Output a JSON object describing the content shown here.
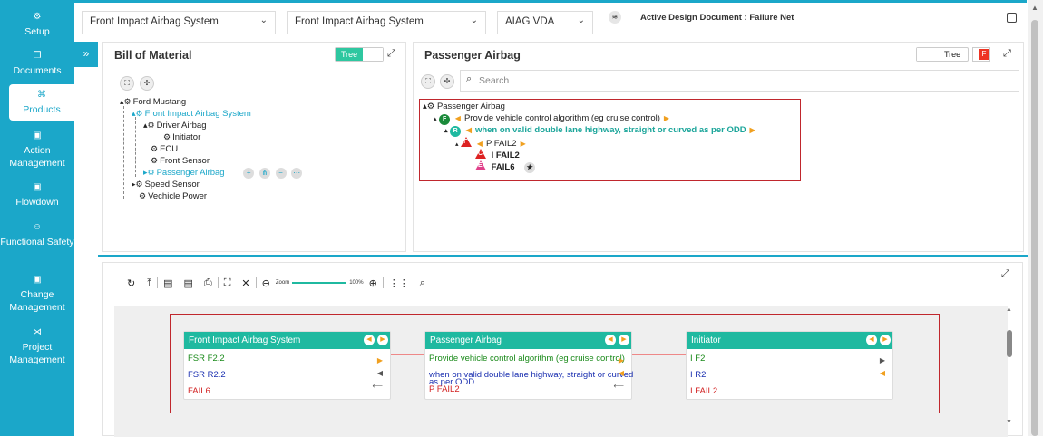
{
  "sidebar": {
    "items": [
      {
        "label": "Setup",
        "icon": "gears-icon"
      },
      {
        "label": "Documents",
        "icon": "documents-icon"
      },
      {
        "label": "Products",
        "icon": "products-icon",
        "active": true
      },
      {
        "label": "Action Management",
        "icon": "action-icon"
      },
      {
        "label": "Flowdown",
        "icon": "flowdown-icon"
      },
      {
        "label": "Functional Safety",
        "icon": "safety-icon"
      },
      {
        "label": "Change Management",
        "icon": "change-icon"
      },
      {
        "label": "Project Management",
        "icon": "project-icon"
      }
    ]
  },
  "topbar": {
    "select1": "Front Impact Airbag System",
    "select2": "Front Impact Airbag System",
    "select3": "AIAG VDA",
    "active_doc": "Active Design Document : Failure Net"
  },
  "bom": {
    "title": "Bill of Material",
    "toggle_label": "Tree",
    "tree": [
      {
        "label": "Ford Mustang",
        "level": 0,
        "teal": false
      },
      {
        "label": "Front Impact Airbag System",
        "level": 1,
        "teal": true
      },
      {
        "label": "Driver Airbag",
        "level": 2,
        "teal": false
      },
      {
        "label": "Initiator",
        "level": 3,
        "teal": false
      },
      {
        "label": "ECU",
        "level": 2,
        "teal": false
      },
      {
        "label": "Front Sensor",
        "level": 2,
        "teal": false
      },
      {
        "label": "Passenger Airbag",
        "level": 2,
        "teal": true
      },
      {
        "label": "Speed Sensor",
        "level": 1,
        "teal": false
      },
      {
        "label": "Vechicle Power",
        "level": 1,
        "teal": false
      }
    ]
  },
  "failure_panel": {
    "title": "Passenger Airbag",
    "toggle_label": "Tree",
    "f_badge": "F",
    "search_placeholder": "Search",
    "nodes": {
      "root": "Passenger Airbag",
      "function": "Provide vehicle control algorithm (eg cruise control)",
      "function_badge": "F",
      "requirement": "when on valid double lane highway, straight or curved as per ODD",
      "requirement_badge": "R",
      "fail_parent": "P FAIL2",
      "fail_parent_badge": "F",
      "fail_child1": "I FAIL2",
      "fail_child1_badge": "C",
      "fail_child2": "FAIL6",
      "fail_child2_badge": "E"
    }
  },
  "diagram": {
    "zoom_label": "Zoom",
    "zoom_value": "100%",
    "cards": [
      {
        "title": "Front Impact Airbag System",
        "lines": [
          {
            "text": "FSR F2.2",
            "color": "#1a8a1a"
          },
          {
            "text": "FSR R2.2",
            "color": "#1a2fb0"
          },
          {
            "text": "FAIL6",
            "color": "#d22222"
          }
        ]
      },
      {
        "title": "Passenger Airbag",
        "lines": [
          {
            "text": "Provide vehicle control algorithm (eg cruise control)",
            "color": "#1a8a1a"
          },
          {
            "text": "when on valid double lane highway, straight or curved",
            "color": "#1a2fb0"
          },
          {
            "text": "as per ODD",
            "color": "#1a2fb0"
          },
          {
            "text": "P FAIL2",
            "color": "#d22222"
          }
        ]
      },
      {
        "title": "Initiator",
        "lines": [
          {
            "text": "I F2",
            "color": "#1a8a1a"
          },
          {
            "text": "I R2",
            "color": "#1a2fb0"
          },
          {
            "text": "I FAIL2",
            "color": "#d22222"
          }
        ]
      }
    ]
  },
  "colors": {
    "accent": "#1ba7c9",
    "node_header": "#1fb9a0",
    "highlight_border": "#c0272d"
  }
}
